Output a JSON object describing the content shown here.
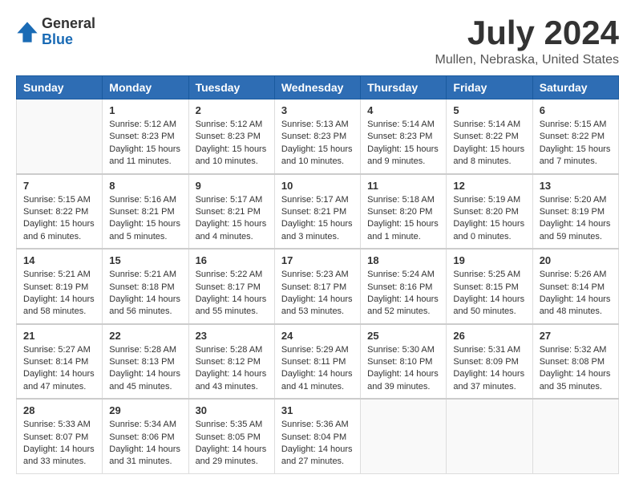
{
  "header": {
    "logo_general": "General",
    "logo_blue": "Blue",
    "title": "July 2024",
    "location": "Mullen, Nebraska, United States"
  },
  "calendar": {
    "days_of_week": [
      "Sunday",
      "Monday",
      "Tuesday",
      "Wednesday",
      "Thursday",
      "Friday",
      "Saturday"
    ],
    "weeks": [
      [
        {
          "day": "",
          "info": ""
        },
        {
          "day": "1",
          "info": "Sunrise: 5:12 AM\nSunset: 8:23 PM\nDaylight: 15 hours\nand 11 minutes."
        },
        {
          "day": "2",
          "info": "Sunrise: 5:12 AM\nSunset: 8:23 PM\nDaylight: 15 hours\nand 10 minutes."
        },
        {
          "day": "3",
          "info": "Sunrise: 5:13 AM\nSunset: 8:23 PM\nDaylight: 15 hours\nand 10 minutes."
        },
        {
          "day": "4",
          "info": "Sunrise: 5:14 AM\nSunset: 8:23 PM\nDaylight: 15 hours\nand 9 minutes."
        },
        {
          "day": "5",
          "info": "Sunrise: 5:14 AM\nSunset: 8:22 PM\nDaylight: 15 hours\nand 8 minutes."
        },
        {
          "day": "6",
          "info": "Sunrise: 5:15 AM\nSunset: 8:22 PM\nDaylight: 15 hours\nand 7 minutes."
        }
      ],
      [
        {
          "day": "7",
          "info": "Sunrise: 5:15 AM\nSunset: 8:22 PM\nDaylight: 15 hours\nand 6 minutes."
        },
        {
          "day": "8",
          "info": "Sunrise: 5:16 AM\nSunset: 8:21 PM\nDaylight: 15 hours\nand 5 minutes."
        },
        {
          "day": "9",
          "info": "Sunrise: 5:17 AM\nSunset: 8:21 PM\nDaylight: 15 hours\nand 4 minutes."
        },
        {
          "day": "10",
          "info": "Sunrise: 5:17 AM\nSunset: 8:21 PM\nDaylight: 15 hours\nand 3 minutes."
        },
        {
          "day": "11",
          "info": "Sunrise: 5:18 AM\nSunset: 8:20 PM\nDaylight: 15 hours\nand 1 minute."
        },
        {
          "day": "12",
          "info": "Sunrise: 5:19 AM\nSunset: 8:20 PM\nDaylight: 15 hours\nand 0 minutes."
        },
        {
          "day": "13",
          "info": "Sunrise: 5:20 AM\nSunset: 8:19 PM\nDaylight: 14 hours\nand 59 minutes."
        }
      ],
      [
        {
          "day": "14",
          "info": "Sunrise: 5:21 AM\nSunset: 8:19 PM\nDaylight: 14 hours\nand 58 minutes."
        },
        {
          "day": "15",
          "info": "Sunrise: 5:21 AM\nSunset: 8:18 PM\nDaylight: 14 hours\nand 56 minutes."
        },
        {
          "day": "16",
          "info": "Sunrise: 5:22 AM\nSunset: 8:17 PM\nDaylight: 14 hours\nand 55 minutes."
        },
        {
          "day": "17",
          "info": "Sunrise: 5:23 AM\nSunset: 8:17 PM\nDaylight: 14 hours\nand 53 minutes."
        },
        {
          "day": "18",
          "info": "Sunrise: 5:24 AM\nSunset: 8:16 PM\nDaylight: 14 hours\nand 52 minutes."
        },
        {
          "day": "19",
          "info": "Sunrise: 5:25 AM\nSunset: 8:15 PM\nDaylight: 14 hours\nand 50 minutes."
        },
        {
          "day": "20",
          "info": "Sunrise: 5:26 AM\nSunset: 8:14 PM\nDaylight: 14 hours\nand 48 minutes."
        }
      ],
      [
        {
          "day": "21",
          "info": "Sunrise: 5:27 AM\nSunset: 8:14 PM\nDaylight: 14 hours\nand 47 minutes."
        },
        {
          "day": "22",
          "info": "Sunrise: 5:28 AM\nSunset: 8:13 PM\nDaylight: 14 hours\nand 45 minutes."
        },
        {
          "day": "23",
          "info": "Sunrise: 5:28 AM\nSunset: 8:12 PM\nDaylight: 14 hours\nand 43 minutes."
        },
        {
          "day": "24",
          "info": "Sunrise: 5:29 AM\nSunset: 8:11 PM\nDaylight: 14 hours\nand 41 minutes."
        },
        {
          "day": "25",
          "info": "Sunrise: 5:30 AM\nSunset: 8:10 PM\nDaylight: 14 hours\nand 39 minutes."
        },
        {
          "day": "26",
          "info": "Sunrise: 5:31 AM\nSunset: 8:09 PM\nDaylight: 14 hours\nand 37 minutes."
        },
        {
          "day": "27",
          "info": "Sunrise: 5:32 AM\nSunset: 8:08 PM\nDaylight: 14 hours\nand 35 minutes."
        }
      ],
      [
        {
          "day": "28",
          "info": "Sunrise: 5:33 AM\nSunset: 8:07 PM\nDaylight: 14 hours\nand 33 minutes."
        },
        {
          "day": "29",
          "info": "Sunrise: 5:34 AM\nSunset: 8:06 PM\nDaylight: 14 hours\nand 31 minutes."
        },
        {
          "day": "30",
          "info": "Sunrise: 5:35 AM\nSunset: 8:05 PM\nDaylight: 14 hours\nand 29 minutes."
        },
        {
          "day": "31",
          "info": "Sunrise: 5:36 AM\nSunset: 8:04 PM\nDaylight: 14 hours\nand 27 minutes."
        },
        {
          "day": "",
          "info": ""
        },
        {
          "day": "",
          "info": ""
        },
        {
          "day": "",
          "info": ""
        }
      ]
    ]
  }
}
